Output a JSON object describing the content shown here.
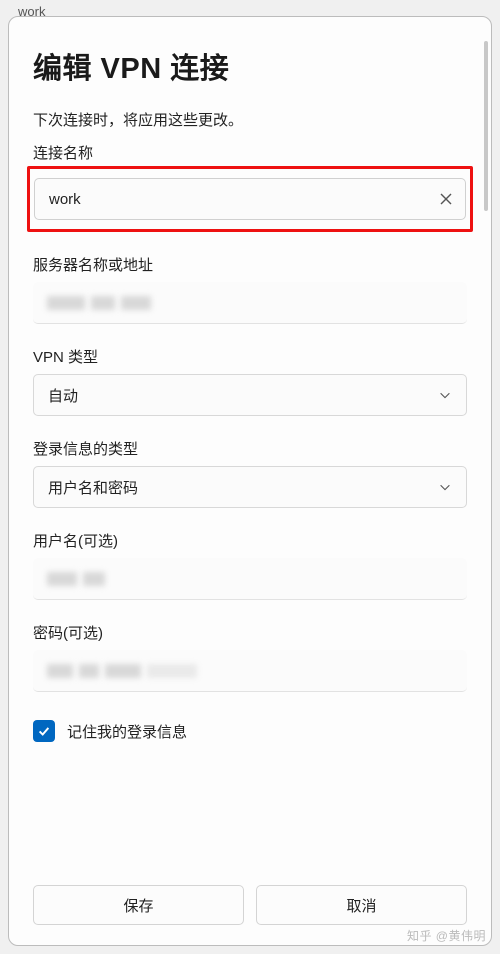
{
  "background": {
    "behind_text": "work"
  },
  "dialog": {
    "title": "编辑 VPN 连接",
    "subtitle": "下次连接时，将应用这些更改。",
    "fields": {
      "connection_name": {
        "label": "连接名称",
        "value": "work"
      },
      "server": {
        "label": "服务器名称或地址"
      },
      "vpn_type": {
        "label": "VPN 类型",
        "value": "自动"
      },
      "signin_type": {
        "label": "登录信息的类型",
        "value": "用户名和密码"
      },
      "username": {
        "label": "用户名(可选)"
      },
      "password": {
        "label": "密码(可选)"
      }
    },
    "remember": {
      "label": "记住我的登录信息",
      "checked": true
    },
    "buttons": {
      "save": "保存",
      "cancel": "取消"
    }
  },
  "watermark": "知乎 @黄伟明"
}
